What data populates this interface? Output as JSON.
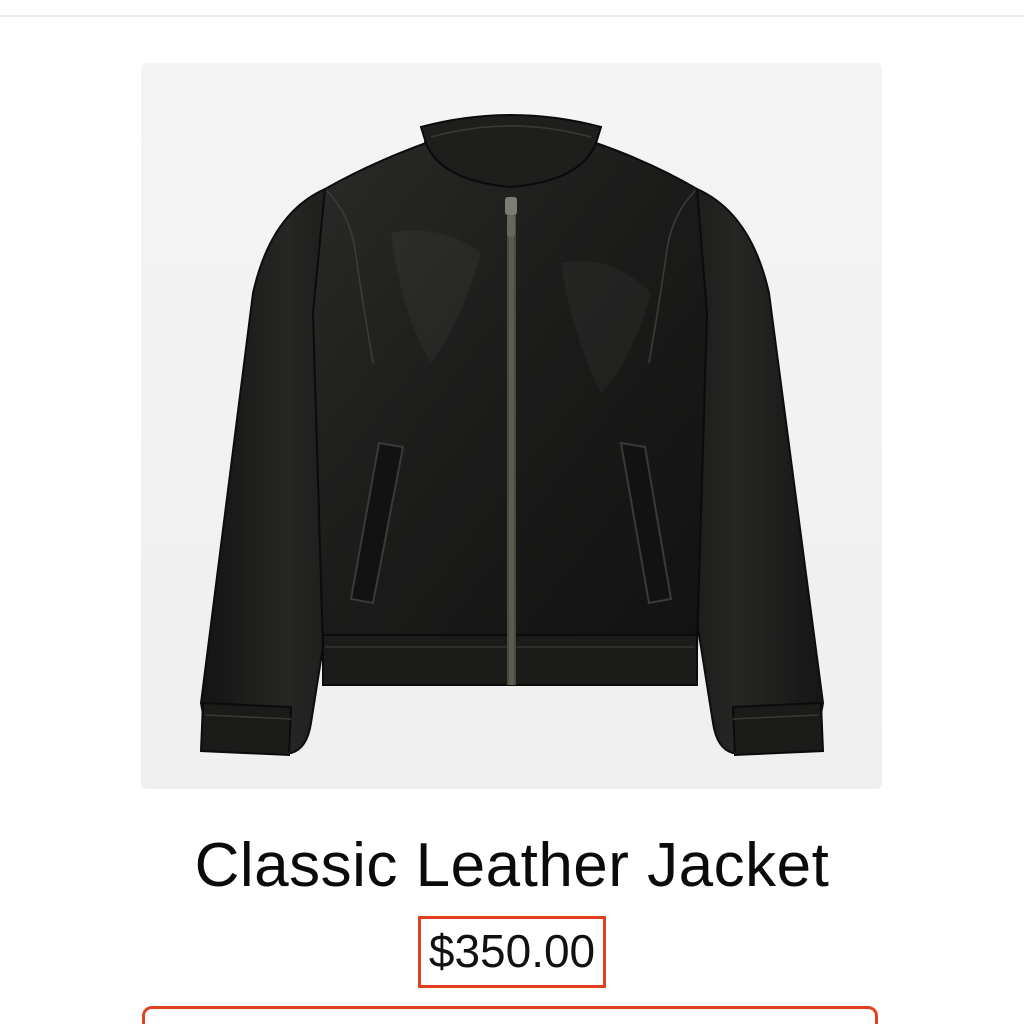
{
  "product": {
    "title": "Classic Leather Jacket",
    "price": "$350.00",
    "image_subject": "black-leather-jacket"
  },
  "colors": {
    "accent": "#e2401f",
    "text": "#0b0b0b",
    "image_background": "#f2f2f2"
  }
}
